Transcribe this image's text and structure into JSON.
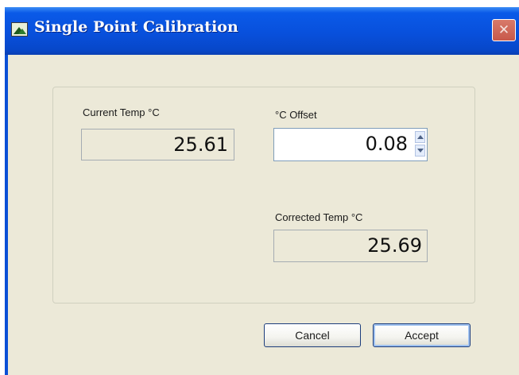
{
  "window": {
    "title": "Single Point Calibration",
    "close_glyph": "✕"
  },
  "fields": {
    "current_temp": {
      "label": "Current Temp °C",
      "value": "25.61"
    },
    "offset": {
      "label": "°C Offset",
      "value": "0.08"
    },
    "corrected_temp": {
      "label": "Corrected Temp °C",
      "value": "25.69"
    }
  },
  "buttons": {
    "cancel": "Cancel",
    "accept": "Accept"
  },
  "icons": {
    "app": "landscape-icon",
    "spin_up": "chevron-up-icon",
    "spin_down": "chevron-down-icon",
    "close": "close-icon"
  },
  "colors": {
    "titlebar": "#0850dc",
    "dialog_bg": "#ece9d8",
    "readonly_bg": "#ece9d8",
    "input_border": "#7f9db9"
  }
}
